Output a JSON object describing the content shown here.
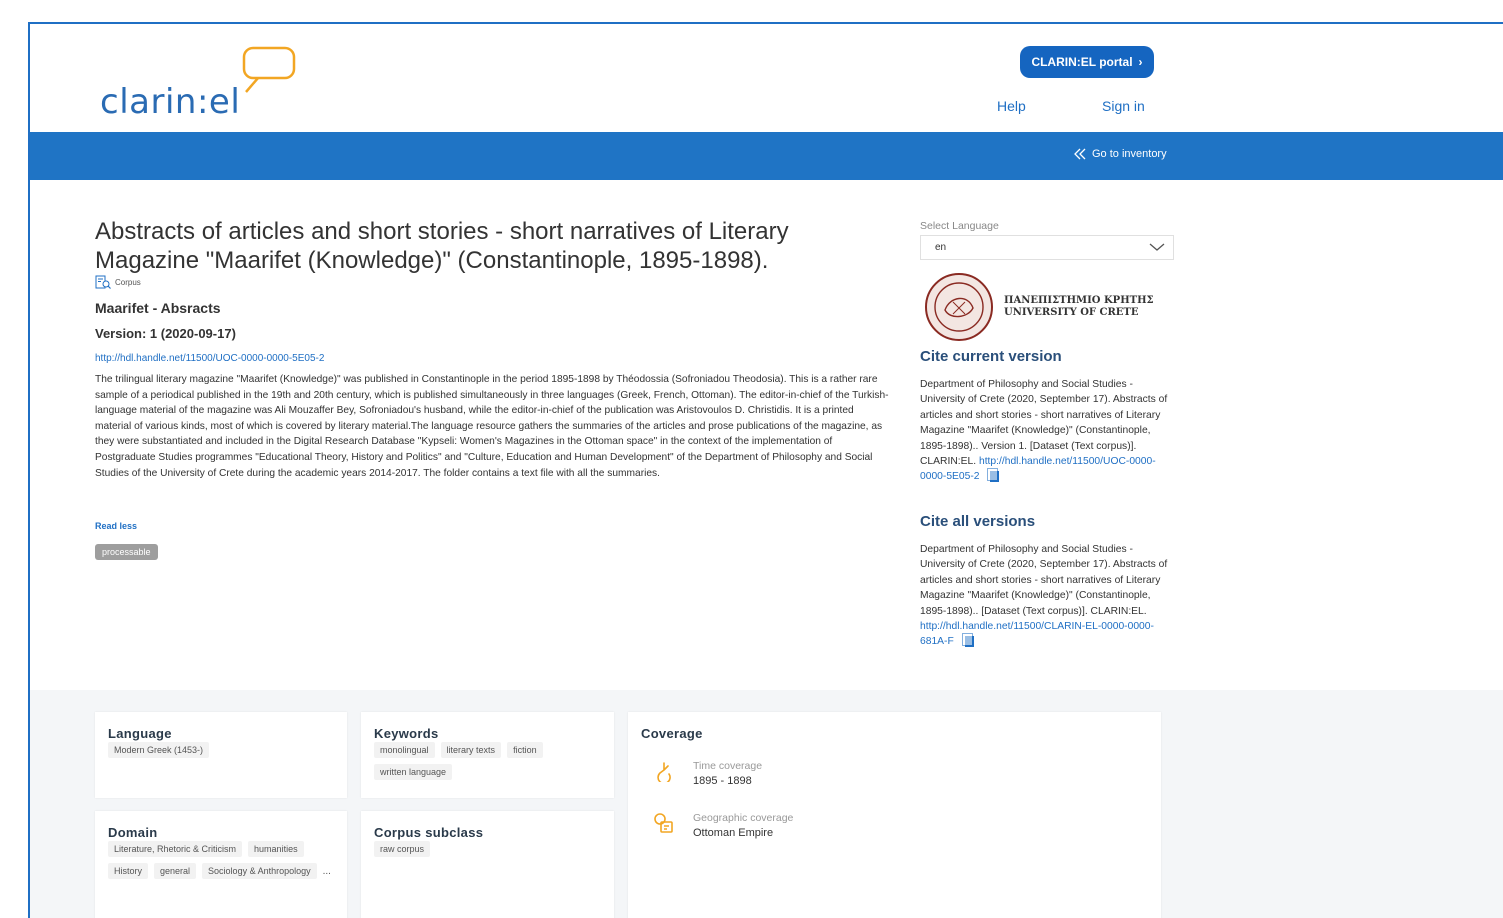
{
  "header": {
    "logo_text": "clarin:el",
    "portal_button": "CLARIN:EL portal",
    "help": "Help",
    "sign_in": "Sign in",
    "go_to_inventory": "Go to inventory"
  },
  "resource": {
    "title": "Abstracts of articles and short stories - short narratives of Literary Magazine \"Maarifet (Knowledge)\" (Constantinople, 1895-1898).",
    "type_tag": "Corpus",
    "short_name": "Maarifet - Absracts",
    "version": "Version: 1 (2020-09-17)",
    "handle": "http://hdl.handle.net/11500/UOC-0000-0000-5E05-2",
    "description": "The trilingual literary magazine \"Maarifet (Knowledge)\" was published in Constantinople in the period 1895-1898 by Théodossia (Sofroniadou Theodosia). This is a rather rare sample of a periodical published in the 19th and 20th century, which is published simultaneously in three languages (Greek, French, Ottoman). The editor-in-chief of the Turkish-language material of the magazine was Ali Mouzaffer Bey, Sofroniadou's husband, while the editor-in-chief of the publication was Aristovoulos D. Christidis. It is a printed material of various kinds, most of which is covered by literary material.The language resource gathers the summaries of the articles and prose publications of the magazine, as they were substantiated and included in the Digital Research Database \"Kypseli: Women's Magazines in the Ottoman space\" in the context of the implementation of Postgraduate Studies programmes \"Educational Theory, History and Politics\" and \"Culture, Education and Human Development\" of the Department of Philosophy and Social Studies of the University of Crete during the academic years 2014-2017. The folder contains a text file with all the summaries.",
    "read_less": "Read less",
    "badge": "processable"
  },
  "sidebar": {
    "select_language_label": "Select Language",
    "selected_language": "en",
    "university_greek": "ΠΑΝΕΠΙΣΤΗΜΙΟ ΚΡΗΤΗΣ",
    "university_english": "UNIVERSITY OF CRETE",
    "cite_current_heading": "Cite current version",
    "cite_current_text": "Department of Philosophy and Social Studies - University of Crete (2020, September 17). Abstracts of articles and short stories - short narratives of Literary Magazine \"Maarifet (Knowledge)\" (Constantinople, 1895-1898).. Version 1. [Dataset (Text corpus)]. CLARIN:EL.",
    "cite_current_link": "http://hdl.handle.net/11500/UOC-0000-0000-5E05-2",
    "cite_all_heading": "Cite all versions",
    "cite_all_text": "Department of Philosophy and Social Studies - University of Crete (2020, September 17). Abstracts of articles and short stories - short narratives of Literary Magazine \"Maarifet (Knowledge)\" (Constantinople, 1895-1898).. [Dataset (Text corpus)]. CLARIN:EL.",
    "cite_all_link": "http://hdl.handle.net/11500/CLARIN-EL-0000-0000-681A-F"
  },
  "cards": {
    "language": {
      "title": "Language",
      "chips": [
        "Modern Greek (1453-)"
      ]
    },
    "keywords": {
      "title": "Keywords",
      "chips": [
        "monolingual",
        "literary texts",
        "fiction",
        "written language"
      ]
    },
    "domain": {
      "title": "Domain",
      "chips": [
        "Literature, Rhetoric & Criticism",
        "humanities",
        "History",
        "general",
        "Sociology & Anthropology"
      ],
      "more": "..."
    },
    "corpus_subclass": {
      "title": "Corpus subclass",
      "chips": [
        "raw corpus"
      ]
    },
    "coverage": {
      "title": "Coverage",
      "time_label": "Time coverage",
      "time_value": "1895 - 1898",
      "geo_label": "Geographic coverage",
      "geo_value": "Ottoman Empire"
    }
  },
  "colors": {
    "brand_blue": "#1f74c5",
    "accent_orange": "#f2a623"
  },
  "icons": [
    "speech-bubble-icon",
    "chevron-right-icon",
    "double-chevron-left-icon",
    "corpus-icon",
    "chevron-down-icon",
    "university-seal-icon",
    "copy-icon",
    "hourglass-icon",
    "map-icon"
  ]
}
